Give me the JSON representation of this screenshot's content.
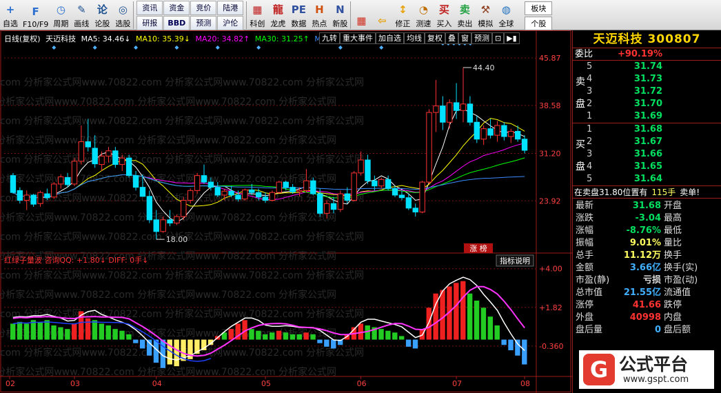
{
  "toolbar": {
    "buttons": [
      {
        "label": "自选",
        "icon": "+",
        "color": "#2a6fd0"
      },
      {
        "label": "F10/F9",
        "icon": "F",
        "color": "#2a6fd0"
      },
      {
        "label": "周期",
        "icon": "◷",
        "color": "#2a6fd0"
      },
      {
        "label": "画线",
        "icon": "✎",
        "color": "#1a4f90"
      },
      {
        "label": "论股",
        "icon": "论",
        "color": "#1a4f90"
      },
      {
        "label": "选股",
        "icon": "◎",
        "color": "#1a4f90"
      }
    ],
    "grid": [
      "资讯",
      "资金",
      "竞价",
      "陆港",
      "研报",
      "BBD",
      "预测",
      "沪伦"
    ],
    "buttons2": [
      {
        "label": "科创",
        "icon": "▦",
        "color": "#c02020"
      },
      {
        "label": "龙虎",
        "icon": "龍",
        "color": "#c02020"
      },
      {
        "label": "数据",
        "icon": "PE",
        "color": "#3050a0"
      },
      {
        "label": "热点",
        "icon": "H",
        "color": "#d05010"
      },
      {
        "label": "新股",
        "icon": "N",
        "color": "#3050a0"
      }
    ],
    "buttons3": [
      {
        "label": "",
        "icon": "▦",
        "color": "#d03020"
      },
      {
        "label": "",
        "icon": "⇦",
        "color": "#e8a000"
      },
      {
        "label": "修正",
        "icon": "↕",
        "color": "#e8a000"
      },
      {
        "label": "测速",
        "icon": "◔",
        "color": "#c07000"
      },
      {
        "label": "买入",
        "icon": "买",
        "color": "#c02020"
      },
      {
        "label": "卖出",
        "icon": "卖",
        "color": "#20a040"
      },
      {
        "label": "模拟",
        "icon": "⚒",
        "color": "#904020"
      },
      {
        "label": "全球",
        "icon": "◍",
        "color": "#2070c0"
      }
    ],
    "right": [
      "板块",
      "个股"
    ]
  },
  "chart": {
    "header": {
      "period": "日线(复权)",
      "name": "天迈科技",
      "ma5": "MA5: 34.46↓",
      "ma10": "MA10: 35.39↓",
      "ma20": "MA20: 34.82↑",
      "ma30": "MA30: 31.25↑",
      "tail": "M."
    },
    "tabs": [
      "九转",
      "重大事件",
      "加自选",
      "均线",
      "复权",
      "叠",
      "窗",
      "预测"
    ],
    "price_axis": [
      "45.87",
      "38.58",
      "31.20",
      "23.92"
    ],
    "high_label": "44.40",
    "low_label": "18.00",
    "zhangbang": "涨 榜",
    "indicator_title": "红绿子量波 咨询QQ: +1.80↓ DIFF: 0手↓",
    "indicator_button": "指标说明",
    "indicator_axis": [
      "+4.00",
      "+1.82",
      "-0.360"
    ],
    "months": [
      "02",
      "03",
      "04",
      "05",
      "06",
      "07",
      "08"
    ],
    "watermark": "com 分析家公式网www.70822.com 分析家公式网www.70822.com 分析家公式网",
    "watermark2": "www.gspt.com",
    "colors": {
      "up": "#ff3232",
      "down": "#00e0ff",
      "ma5": "#ffffff",
      "ma10": "#ffff00",
      "ma20": "#ff00ff",
      "ma30": "#00ff00",
      "ma60": "#3a8bff"
    }
  },
  "chart_data": {
    "type": "candlestick",
    "title": "天迈科技",
    "y_range": [
      16,
      48
    ],
    "ohlc": [
      [
        27.8,
        28.2,
        25.0,
        25.2
      ],
      [
        25.5,
        26.0,
        23.5,
        24.0
      ],
      [
        24.0,
        25.5,
        22.5,
        24.8
      ],
      [
        24.8,
        25.0,
        23.0,
        23.4
      ],
      [
        23.5,
        25.5,
        23.0,
        25.2
      ],
      [
        25.0,
        25.8,
        24.0,
        24.4
      ],
      [
        24.5,
        26.8,
        24.2,
        26.5
      ],
      [
        26.5,
        28.0,
        25.8,
        27.6
      ],
      [
        27.5,
        28.2,
        26.0,
        26.4
      ],
      [
        26.5,
        30.5,
        26.2,
        30.0
      ],
      [
        30.0,
        35.5,
        29.5,
        33.0
      ],
      [
        33.0,
        36.5,
        31.5,
        32.2
      ],
      [
        32.0,
        34.0,
        29.0,
        29.6
      ],
      [
        29.5,
        31.5,
        28.5,
        30.8
      ],
      [
        30.8,
        32.2,
        29.8,
        31.6
      ],
      [
        31.6,
        32.2,
        29.0,
        29.5
      ],
      [
        29.5,
        31.0,
        28.5,
        30.5
      ],
      [
        30.5,
        31.0,
        27.5,
        27.8
      ],
      [
        27.8,
        28.5,
        25.5,
        26.0
      ],
      [
        26.0,
        28.0,
        25.0,
        24.6
      ],
      [
        24.6,
        25.5,
        20.5,
        21.0
      ],
      [
        21.0,
        22.5,
        18.0,
        19.2
      ],
      [
        19.2,
        21.5,
        19.0,
        21.0
      ],
      [
        21.0,
        22.5,
        20.0,
        20.5
      ],
      [
        20.5,
        21.8,
        20.2,
        21.5
      ],
      [
        21.5,
        24.5,
        21.0,
        24.0
      ],
      [
        24.0,
        25.8,
        23.5,
        25.5
      ],
      [
        25.5,
        28.2,
        25.0,
        27.8
      ],
      [
        27.8,
        29.5,
        26.5,
        26.8
      ],
      [
        26.8,
        27.5,
        25.5,
        26.0
      ],
      [
        26.0,
        26.8,
        24.5,
        24.8
      ],
      [
        24.8,
        25.8,
        24.0,
        25.4
      ],
      [
        25.4,
        26.2,
        24.5,
        24.8
      ],
      [
        24.8,
        25.5,
        23.8,
        24.2
      ],
      [
        24.2,
        25.8,
        24.0,
        25.6
      ],
      [
        25.6,
        26.5,
        24.8,
        25.2
      ],
      [
        25.2,
        25.8,
        24.0,
        24.5
      ],
      [
        24.5,
        25.2,
        23.6,
        24.0
      ],
      [
        24.0,
        25.5,
        23.8,
        25.2
      ],
      [
        25.2,
        27.0,
        25.0,
        26.8
      ],
      [
        26.8,
        27.0,
        25.5,
        26.0
      ],
      [
        26.0,
        26.5,
        25.0,
        25.3
      ],
      [
        25.3,
        26.0,
        24.6,
        25.5
      ],
      [
        25.5,
        28.8,
        25.2,
        27.0
      ],
      [
        27.0,
        27.5,
        24.8,
        25.0
      ],
      [
        25.0,
        25.8,
        21.5,
        22.0
      ],
      [
        22.0,
        24.0,
        21.2,
        23.5
      ],
      [
        23.5,
        24.5,
        22.0,
        22.6
      ],
      [
        22.6,
        25.5,
        22.2,
        25.0
      ],
      [
        25.0,
        26.0,
        23.5,
        24.0
      ],
      [
        24.0,
        28.5,
        23.8,
        28.2
      ],
      [
        28.2,
        31.5,
        27.8,
        30.2
      ],
      [
        30.2,
        31.0,
        26.5,
        27.0
      ],
      [
        27.0,
        27.8,
        25.5,
        26.2
      ],
      [
        26.2,
        27.5,
        25.8,
        27.2
      ],
      [
        27.2,
        27.8,
        25.5,
        25.8
      ],
      [
        25.8,
        26.2,
        24.5,
        24.8
      ],
      [
        24.8,
        25.5,
        24.0,
        24.4
      ],
      [
        24.4,
        25.0,
        22.5,
        22.8
      ],
      [
        22.8,
        23.5,
        21.5,
        22.2
      ],
      [
        22.2,
        27.0,
        22.0,
        26.8
      ],
      [
        26.8,
        38.0,
        26.5,
        37.5
      ],
      [
        37.5,
        42.5,
        34.5,
        38.5
      ],
      [
        38.5,
        40.0,
        34.8,
        36.0
      ],
      [
        36.0,
        39.5,
        35.0,
        39.0
      ],
      [
        39.0,
        42.0,
        36.5,
        37.8
      ],
      [
        37.8,
        44.4,
        36.0,
        38.8
      ],
      [
        38.8,
        40.0,
        35.5,
        36.0
      ],
      [
        36.0,
        37.0,
        32.8,
        33.4
      ],
      [
        33.4,
        35.5,
        32.5,
        35.0
      ],
      [
        35.0,
        36.5,
        33.5,
        34.0
      ],
      [
        34.0,
        36.2,
        33.0,
        35.5
      ],
      [
        35.5,
        36.0,
        33.2,
        33.8
      ],
      [
        33.8,
        35.0,
        32.8,
        34.6
      ],
      [
        34.6,
        35.5,
        33.0,
        33.4
      ],
      [
        33.4,
        34.0,
        31.2,
        31.68
      ]
    ],
    "indicator_bars": [
      [
        0.9,
        "g"
      ],
      [
        1.0,
        "g"
      ],
      [
        0.9,
        "g"
      ],
      [
        1.1,
        "g"
      ],
      [
        1.0,
        "g"
      ],
      [
        1.1,
        "g"
      ],
      [
        0.8,
        "g"
      ],
      [
        0.7,
        "g"
      ],
      [
        0.6,
        "g"
      ],
      [
        0.9,
        "r"
      ],
      [
        1.6,
        "r"
      ],
      [
        1.2,
        "r"
      ],
      [
        1.1,
        "g"
      ],
      [
        0.9,
        "g"
      ],
      [
        0.8,
        "g"
      ],
      [
        0.6,
        "g"
      ],
      [
        0.5,
        "g"
      ],
      [
        0.3,
        "g"
      ],
      [
        -0.2,
        "b"
      ],
      [
        -0.5,
        "b"
      ],
      [
        -0.9,
        "b"
      ],
      [
        -1.3,
        "b"
      ],
      [
        -1.6,
        "b"
      ],
      [
        -1.4,
        "y"
      ],
      [
        -1.5,
        "y"
      ],
      [
        -1.2,
        "y"
      ],
      [
        -1.1,
        "y"
      ],
      [
        -0.8,
        "y"
      ],
      [
        -0.6,
        "y"
      ],
      [
        -0.3,
        "y"
      ],
      [
        0.2,
        "r"
      ],
      [
        0.4,
        "g"
      ],
      [
        0.6,
        "r"
      ],
      [
        0.9,
        "r"
      ],
      [
        1.1,
        "r"
      ],
      [
        0.6,
        "g"
      ],
      [
        0.5,
        "g"
      ],
      [
        0.3,
        "g"
      ],
      [
        0.4,
        "g"
      ],
      [
        0.5,
        "r"
      ],
      [
        0.4,
        "g"
      ],
      [
        0.3,
        "g"
      ],
      [
        0.3,
        "g"
      ],
      [
        0.4,
        "r"
      ],
      [
        0.3,
        "g"
      ],
      [
        -0.2,
        "b"
      ],
      [
        -0.4,
        "b"
      ],
      [
        -0.5,
        "b"
      ],
      [
        -0.3,
        "b"
      ],
      [
        0.3,
        "r"
      ],
      [
        0.7,
        "r"
      ],
      [
        0.9,
        "r"
      ],
      [
        0.8,
        "g"
      ],
      [
        0.7,
        "g"
      ],
      [
        0.6,
        "g"
      ],
      [
        0.5,
        "g"
      ],
      [
        0.4,
        "g"
      ],
      [
        0.2,
        "g"
      ],
      [
        -0.4,
        "b"
      ],
      [
        -0.5,
        "b"
      ],
      [
        0.6,
        "r"
      ],
      [
        1.8,
        "r"
      ],
      [
        2.6,
        "r"
      ],
      [
        2.8,
        "r"
      ],
      [
        3.0,
        "r"
      ],
      [
        3.2,
        "r"
      ],
      [
        3.3,
        "r"
      ],
      [
        2.6,
        "g"
      ],
      [
        2.2,
        "g"
      ],
      [
        1.8,
        "g"
      ],
      [
        1.3,
        "g"
      ],
      [
        0.8,
        "g"
      ],
      [
        -0.3,
        "b"
      ],
      [
        -0.6,
        "b"
      ],
      [
        -0.9,
        "b"
      ],
      [
        -1.4,
        "b"
      ]
    ],
    "indicator_range": [
      -2,
      4.3
    ]
  },
  "panel": {
    "title": "天迈科技  300807",
    "weibi_label": "委比",
    "weibi_value": "+90.19%",
    "sell_label": [
      "卖",
      "盘"
    ],
    "buy_label": [
      "买",
      "盘"
    ],
    "sell": [
      [
        "5",
        "31.74"
      ],
      [
        "4",
        "31.73"
      ],
      [
        "3",
        "31.72"
      ],
      [
        "2",
        "31.70"
      ],
      [
        "1",
        "31.69"
      ]
    ],
    "buy": [
      [
        "1",
        "31.68"
      ],
      [
        "2",
        "31.67"
      ],
      [
        "3",
        "31.66"
      ],
      [
        "4",
        "31.65"
      ],
      [
        "5",
        "31.64"
      ]
    ],
    "notice": "在卖盘31.80位置有",
    "notice_vol": "115手",
    "notice_tail": "卖单!",
    "stats": [
      {
        "k": "最新",
        "v": "31.68",
        "c": "#00e060",
        "k2": "开盘"
      },
      {
        "k": "涨跌",
        "v": "-3.04",
        "c": "#00e060",
        "k2": "最高"
      },
      {
        "k": "涨幅",
        "v": "-8.76%",
        "c": "#00e060",
        "k2": "最低"
      },
      {
        "k": "振幅",
        "v": "9.01%",
        "c": "#ffff60",
        "k2": "量比"
      },
      {
        "k": "总手",
        "v": "11.12万",
        "c": "#ffff60",
        "k2": "换手"
      },
      {
        "k": "金额",
        "v": "3.66亿",
        "c": "#40b0ff",
        "k2": "换手(实)"
      },
      {
        "k": "市盈(静)",
        "v": "亏损",
        "c": "#ddd",
        "k2": "市盈(动)"
      },
      {
        "k": "总市值",
        "v": "21.55亿",
        "c": "#40b0ff",
        "k2": "流通值"
      },
      {
        "k": "涨停",
        "v": "41.66",
        "c": "#ff3232",
        "k2": "跌停"
      },
      {
        "k": "外盘",
        "v": "40998",
        "c": "#ff3232",
        "k2": "内盘"
      },
      {
        "k": "盘后量",
        "v": "0",
        "c": "#40b0ff",
        "k2": "盘后额"
      }
    ]
  },
  "logo": {
    "text": "公式平台",
    "url": "www.gspt.com"
  }
}
